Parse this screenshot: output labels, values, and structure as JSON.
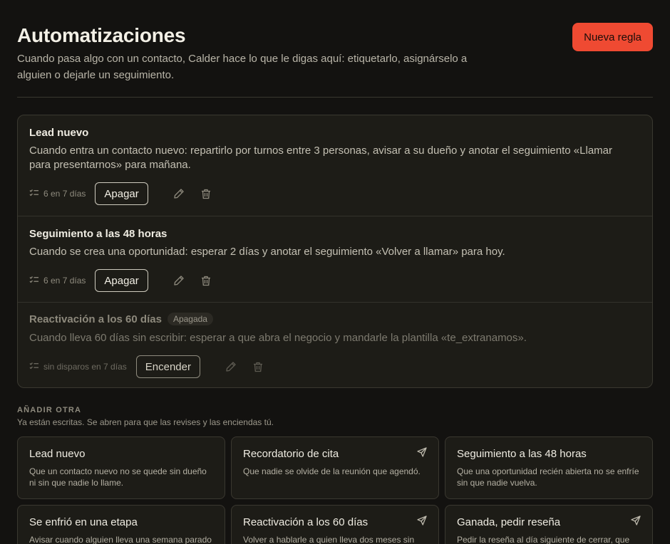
{
  "header": {
    "title": "Automatizaciones",
    "subtitle": "Cuando pasa algo con un contacto, Calder hace lo que le digas aquí: etiquetarlo, asignárselo a alguien o dejarle un seguimiento.",
    "new_rule_label": "Nueva regla"
  },
  "rules": [
    {
      "title": "Lead nuevo",
      "description": "Cuando entra un contacto nuevo: repartirlo por turnos entre 3 personas, avisar a su dueño y anotar el seguimiento «Llamar para presentarnos» para mañana.",
      "fires": "6 en 7 días",
      "toggle_label": "Apagar"
    },
    {
      "title": "Seguimiento a las 48 horas",
      "description": "Cuando se crea una oportunidad: esperar 2 días y anotar el seguimiento «Volver a llamar» para hoy.",
      "fires": "6 en 7 días",
      "toggle_label": "Apagar"
    },
    {
      "title": "Reactivación a los 60 días",
      "badge": "Apagada",
      "description": "Cuando lleva 60 días sin escribir: esperar a que abra el negocio y mandarle la plantilla «te_extranamos».",
      "fires": "sin disparos en 7 días",
      "toggle_label": "Encender"
    }
  ],
  "add_section": {
    "label": "AÑADIR OTRA",
    "hint": "Ya están escritas. Se abren para que las revises y las enciendas tú."
  },
  "templates": [
    {
      "title": "Lead nuevo",
      "description": "Que un contacto nuevo no se quede sin dueño ni sin que nadie lo llame.",
      "icon": ""
    },
    {
      "title": "Recordatorio de cita",
      "description": "Que nadie se olvide de la reunión que agendó.",
      "icon": "send-icon"
    },
    {
      "title": "Seguimiento a las 48 horas",
      "description": "Que una oportunidad recién abierta no se enfríe sin que nadie vuelva.",
      "icon": ""
    },
    {
      "title": "Se enfrió en una etapa",
      "description": "Avisar cuando alguien lleva una semana parado",
      "icon": ""
    },
    {
      "title": "Reactivación a los 60 días",
      "description": "Volver a hablarle a quien lleva dos meses sin",
      "icon": "send-icon"
    },
    {
      "title": "Ganada, pedir reseña",
      "description": "Pedir la reseña al día siguiente de cerrar, que es",
      "icon": "send-icon"
    }
  ],
  "colors": {
    "background": "#131210",
    "card": "#1d1c17",
    "accent": "#ef4a32",
    "border": "#3a3830"
  }
}
